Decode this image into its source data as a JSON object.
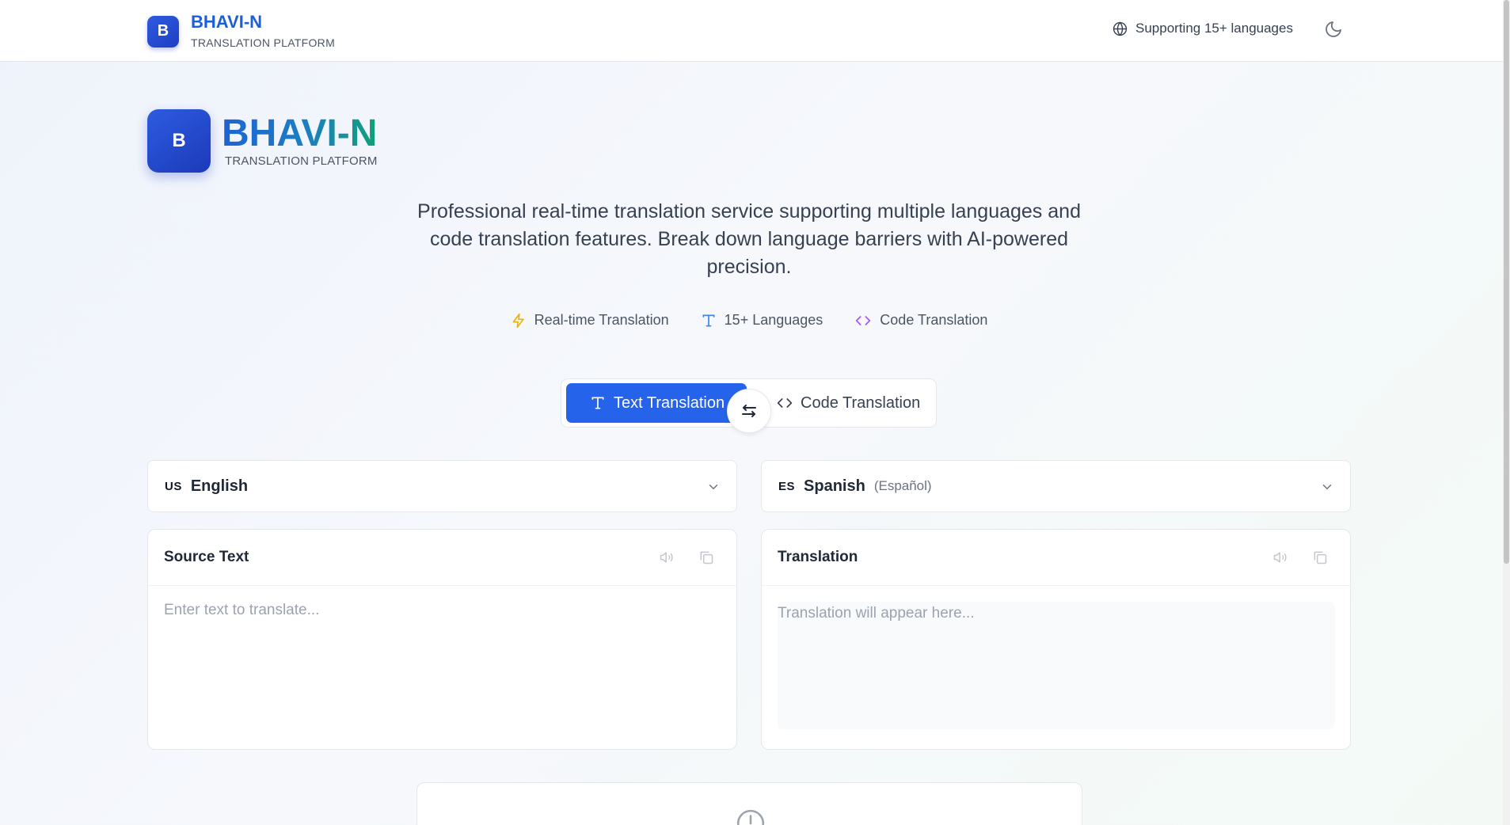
{
  "header": {
    "logo_letter": "B",
    "brand_name": "BHAVI-N",
    "brand_sub": "TRANSLATION PLATFORM",
    "languages_label": "Supporting 15+ languages",
    "theme_icon": "moon-icon"
  },
  "hero": {
    "logo_letter": "B",
    "brand_name": "BHAVI-N",
    "brand_sub": "TRANSLATION PLATFORM",
    "tagline": "Professional real-time translation service supporting multiple languages and code translation features. Break down language barriers with AI-powered precision."
  },
  "features": [
    {
      "label": "Real-time Translation",
      "icon": "lightning-icon",
      "color": "#eab308"
    },
    {
      "label": "15+ Languages",
      "icon": "type-icon",
      "color": "#3b82f6"
    },
    {
      "label": "Code Translation",
      "icon": "code-icon",
      "color": "#a855f7"
    }
  ],
  "mode": {
    "text_label": "Text Translation",
    "code_label": "Code Translation",
    "active": "text"
  },
  "source_lang": {
    "flag": "US",
    "name": "English"
  },
  "target_lang": {
    "flag": "ES",
    "name": "Spanish",
    "native": "(Español)"
  },
  "source_panel": {
    "title": "Source Text",
    "placeholder": "Enter text to translate..."
  },
  "target_panel": {
    "title": "Translation",
    "placeholder": "Translation will appear here..."
  },
  "colors": {
    "accent": "#2563eb",
    "brand_start": "#1e63d6",
    "brand_end": "#12a078"
  }
}
